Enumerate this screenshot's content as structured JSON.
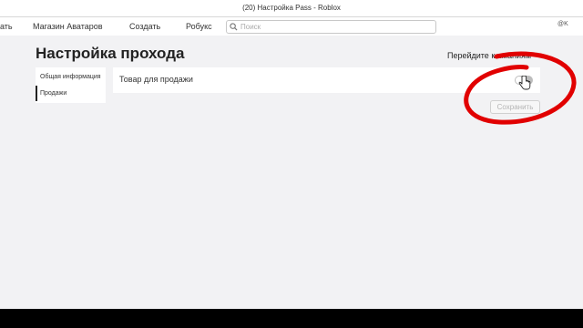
{
  "window": {
    "title": "(20) Настройка Pass - Roblox"
  },
  "nav": {
    "cut_item": "ать",
    "items": [
      "Магазин Аватаров",
      "Создать",
      "Робукс"
    ],
    "search_placeholder": "Поиск",
    "user_cut": "@K"
  },
  "page": {
    "title": "Настройка прохода",
    "goto_link": "Перейдите к иманиям",
    "goto_arrow": "›"
  },
  "sidebar": {
    "items": [
      {
        "label": "Общая информация",
        "active": false
      },
      {
        "label": "Продажи",
        "active": true
      }
    ]
  },
  "sales": {
    "item_for_sale_label": "Товар для продажи",
    "toggle_on": false,
    "save_label": "Сохранить"
  },
  "colors": {
    "annotation": "#e10000",
    "background": "#f2f2f4",
    "panel": "#ffffff"
  },
  "icons": {
    "search": "search-icon",
    "cursor": "hand-cursor-icon"
  }
}
